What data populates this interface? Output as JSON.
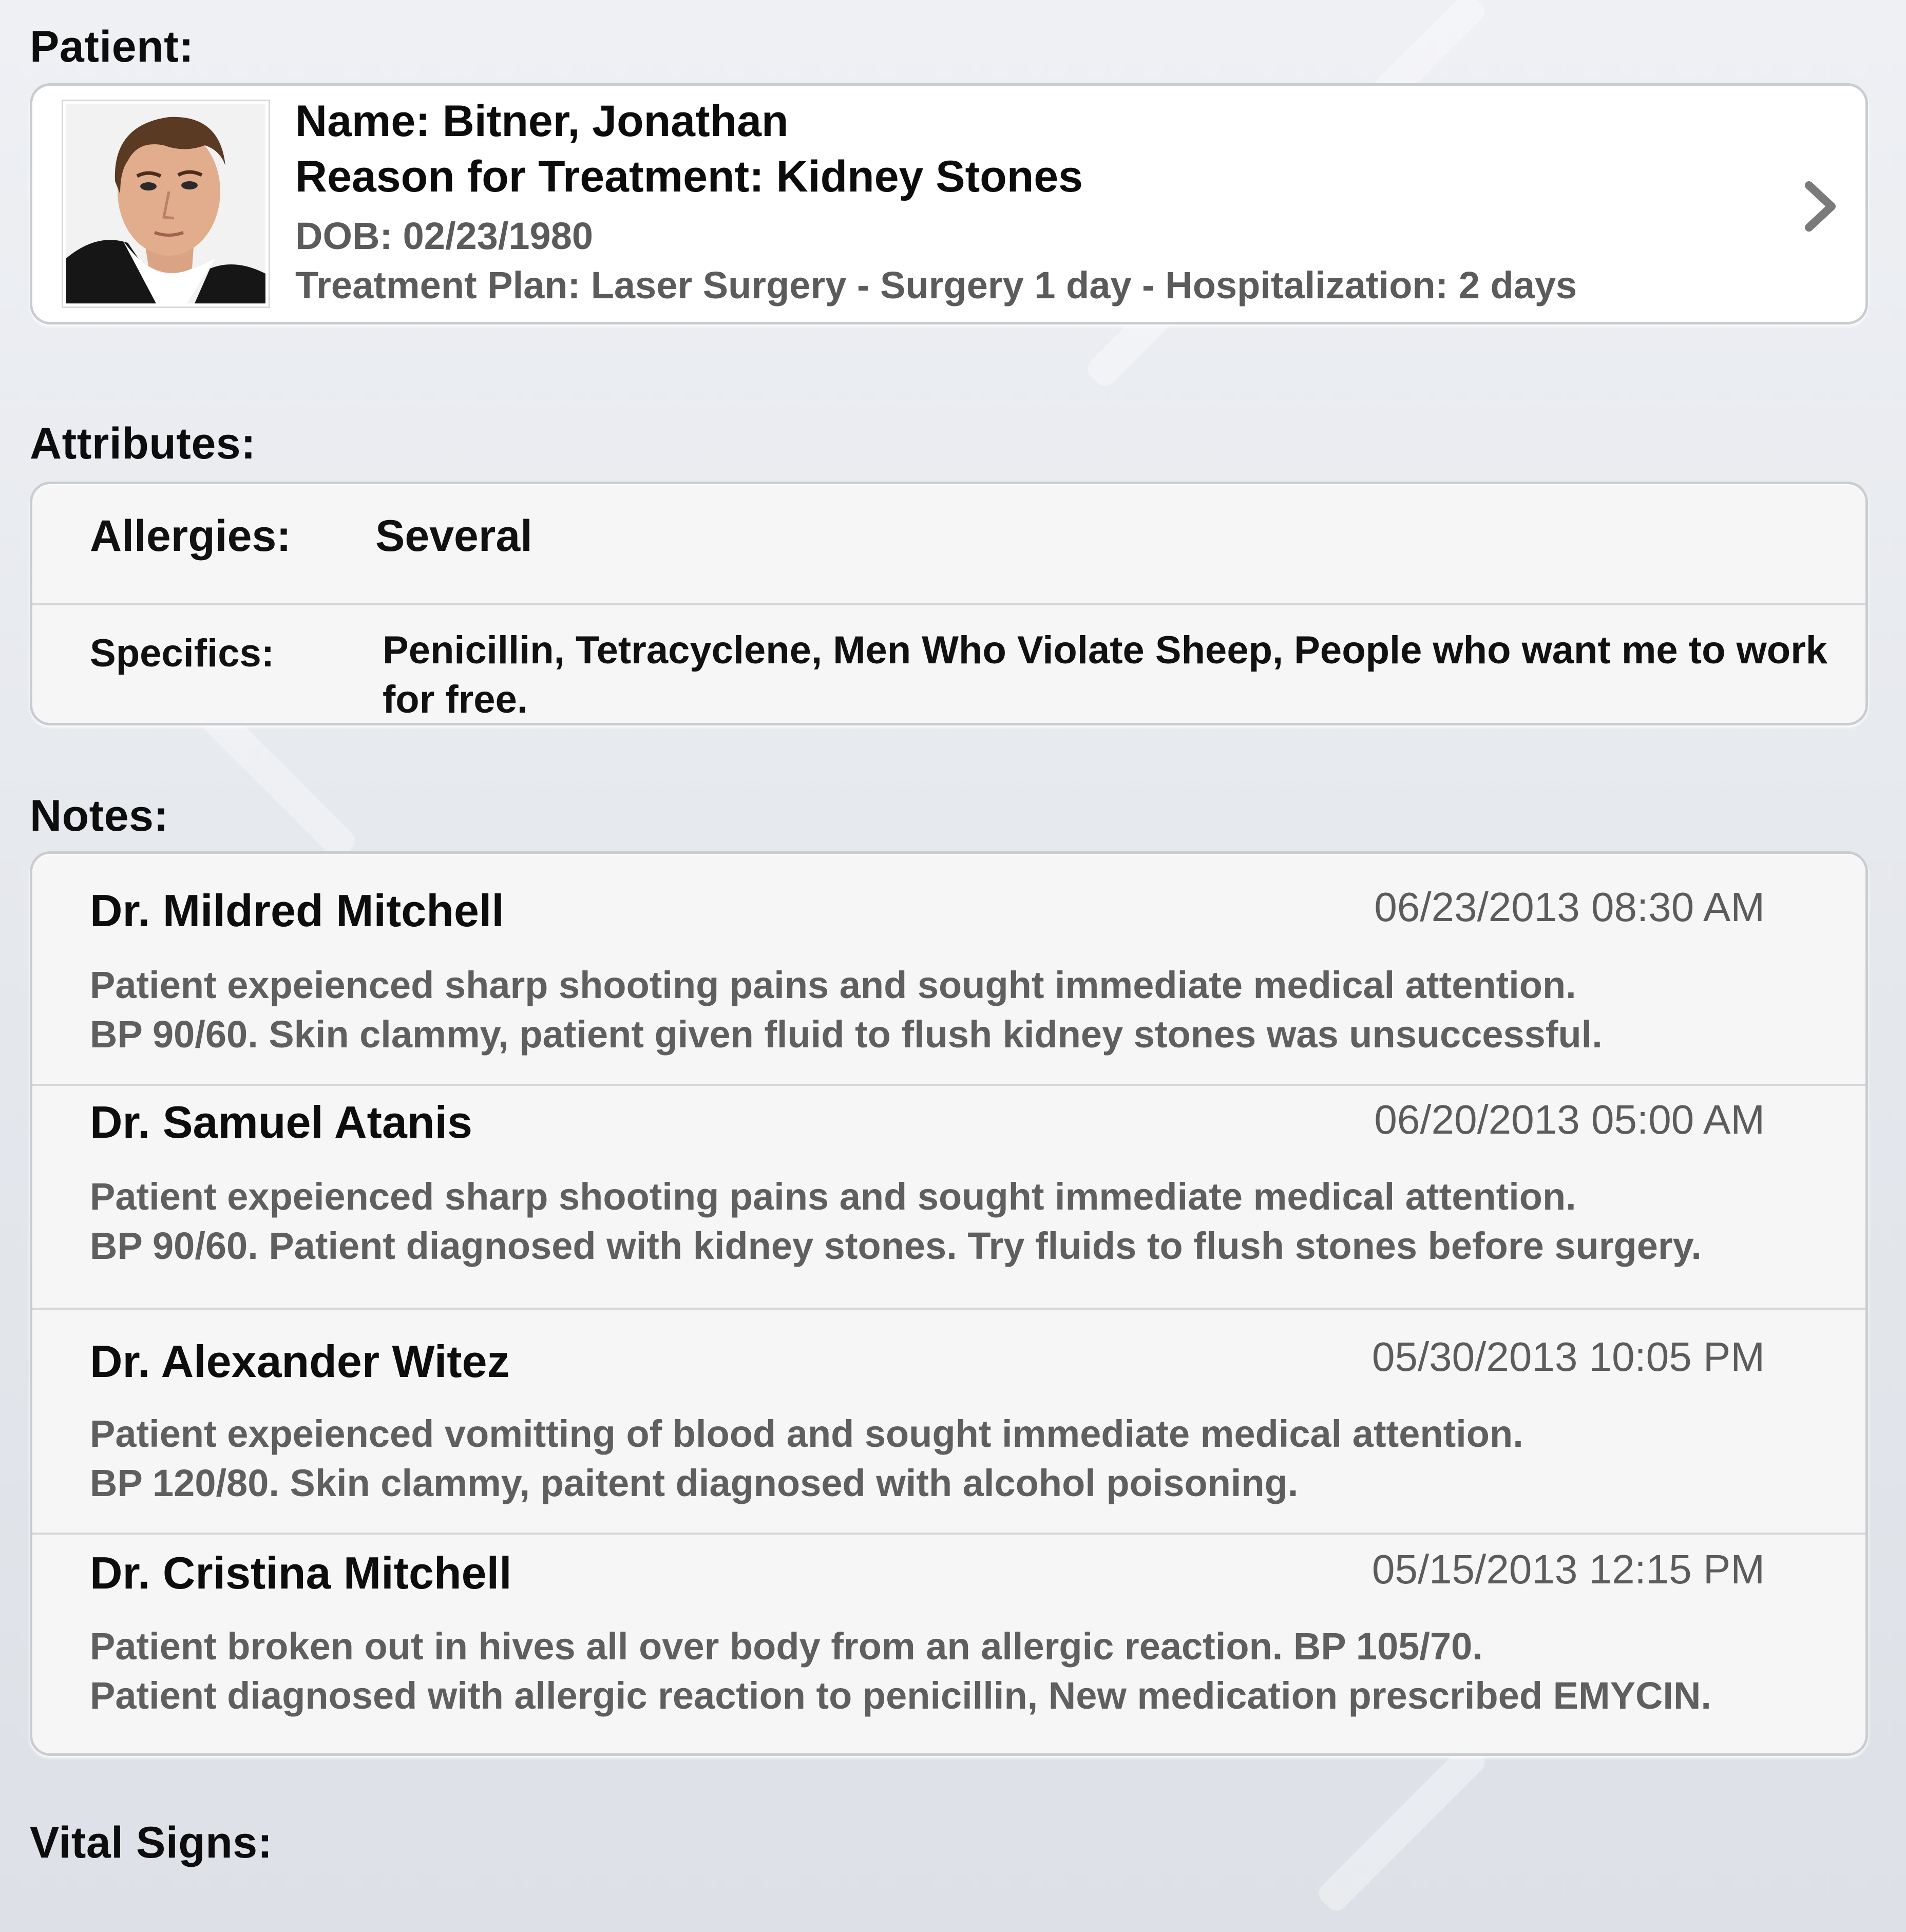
{
  "sections": {
    "patient": "Patient:",
    "attributes": "Attributes:",
    "notes": "Notes:",
    "vitals": "Vital Signs:"
  },
  "patient": {
    "name": "Name: Bitner, Jonathan",
    "reason": "Reason for Treatment: Kidney Stones",
    "dob": "DOB: 02/23/1980",
    "treatment_plan": "Treatment Plan: Laser Surgery - Surgery 1 day - Hospitalization: 2 days",
    "photo_icon": "patient-photo",
    "disclosure_icon": "chevron-right-icon"
  },
  "attributes": {
    "allergies_label": "Allergies:",
    "allergies_value": "Several",
    "specifics_label": "Specifics:",
    "specifics_value": "Penicillin, Tetracyclene, Men Who Violate Sheep, People who want me to work for free."
  },
  "notes": [
    {
      "author": "Dr. Mildred Mitchell",
      "time": "06/23/2013 08:30 AM",
      "line1": "Patient expeienced sharp shooting pains and sought immediate medical attention.",
      "line2": "BP 90/60. Skin clammy, patient given fluid to flush kidney stones was unsuccessful."
    },
    {
      "author": "Dr. Samuel Atanis",
      "time": "06/20/2013 05:00 AM",
      "line1": "Patient expeienced sharp shooting pains and sought immediate medical attention.",
      "line2": "BP 90/60. Patient diagnosed with kidney stones. Try fluids to flush stones before surgery."
    },
    {
      "author": "Dr. Alexander Witez",
      "time": "05/30/2013 10:05 PM",
      "line1": "Patient expeienced vomitting of blood and sought immediate medical attention.",
      "line2": "BP 120/80. Skin clammy, paitent diagnosed with alcohol poisoning."
    },
    {
      "author": "Dr. Cristina Mitchell",
      "time": "05/15/2013 12:15 PM",
      "line1": "Patient broken out in hives all over body from an allergic reaction. BP 105/70.",
      "line2": "Patient diagnosed with allergic reaction to penicillin, New medication prescribed EMYCIN."
    }
  ]
}
